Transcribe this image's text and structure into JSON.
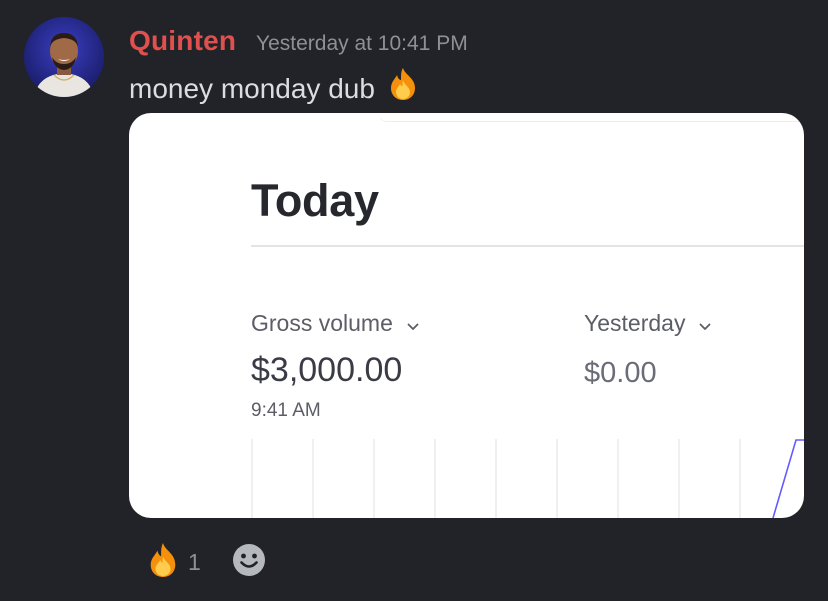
{
  "message": {
    "author": "Quinten",
    "author_color": "#e0504d",
    "timestamp": "Yesterday at 10:41 PM",
    "text": "money monday dub",
    "text_emoji": "fire-emoji",
    "avatar": "user-avatar"
  },
  "attachment": {
    "title": "Today",
    "metrics": [
      {
        "label": "Gross volume",
        "value": "$3,000.00",
        "time": "9:41 AM"
      },
      {
        "label": "Yesterday",
        "value": "$0.00"
      }
    ],
    "chart_line_color": "#635bff"
  },
  "reactions": [
    {
      "emoji": "fire-emoji",
      "count": "1"
    }
  ],
  "add_reaction_icon": "smiley-add-reaction-icon"
}
